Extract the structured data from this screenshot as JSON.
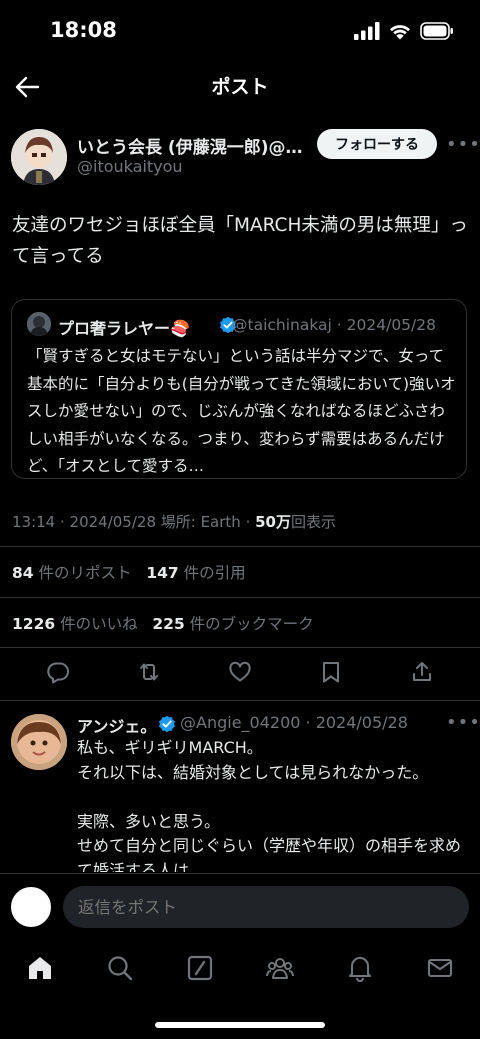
{
  "status_bar": {
    "time": "18:08"
  },
  "header": {
    "title": "ポスト"
  },
  "post": {
    "author_name": "いとう会長 (伊藤滉一郎)@…",
    "author_handle": "@itoukaityou",
    "follow_label": "フォローする",
    "text": "友達のワセジョほぼ全員「MARCH未満の男は無理」って言ってる",
    "quote": {
      "name": "プロ奢ラレヤー🍣",
      "handle_date": "@taichinakaj · 2024/05/28",
      "text": "「賢すぎると女はモテない」という話は半分マジで、女って基本的に「自分よりも(自分が戦ってきた領域において)強いオスしか愛せない」ので、じぶんが強くなればなるほどふさわしい相手がいなくなる。つまり、変わらず需要はあるんだけど、「オスとして愛する…"
    },
    "meta_time": "13:14 · 2024/05/28 場所: Earth · ",
    "views_count": "50万",
    "views_label": "回表示",
    "reposts_count": "84",
    "reposts_label": "件のリポスト",
    "quotes_count": "147",
    "quotes_label": "件の引用",
    "likes_count": "1226",
    "likes_label": "件のいいね",
    "bookmarks_count": "225",
    "bookmarks_label": "件のブックマーク"
  },
  "reply": {
    "name": "アンジェ。",
    "handle_date": "@Angie_04200 · 2024/05/28",
    "text": "私も、ギリギリMARCH。\nそれ以下は、結婚対象としては見られなかった。\n\n実際、多いと思う。\nせめて自分と同じぐらい（学歴や年収）の相手を求めて婚活する人は。"
  },
  "composer": {
    "placeholder": "返信をポスト"
  },
  "colors": {
    "verified": "#1d9bf0",
    "muted": "#71767b",
    "divider": "#2f3336"
  },
  "icons": [
    "back-arrow-icon",
    "more-icon",
    "verified-icon",
    "reply-icon",
    "repost-icon",
    "like-icon",
    "bookmark-icon",
    "share-icon",
    "home-icon",
    "search-icon",
    "grok-icon",
    "communities-icon",
    "notifications-icon",
    "messages-icon"
  ]
}
